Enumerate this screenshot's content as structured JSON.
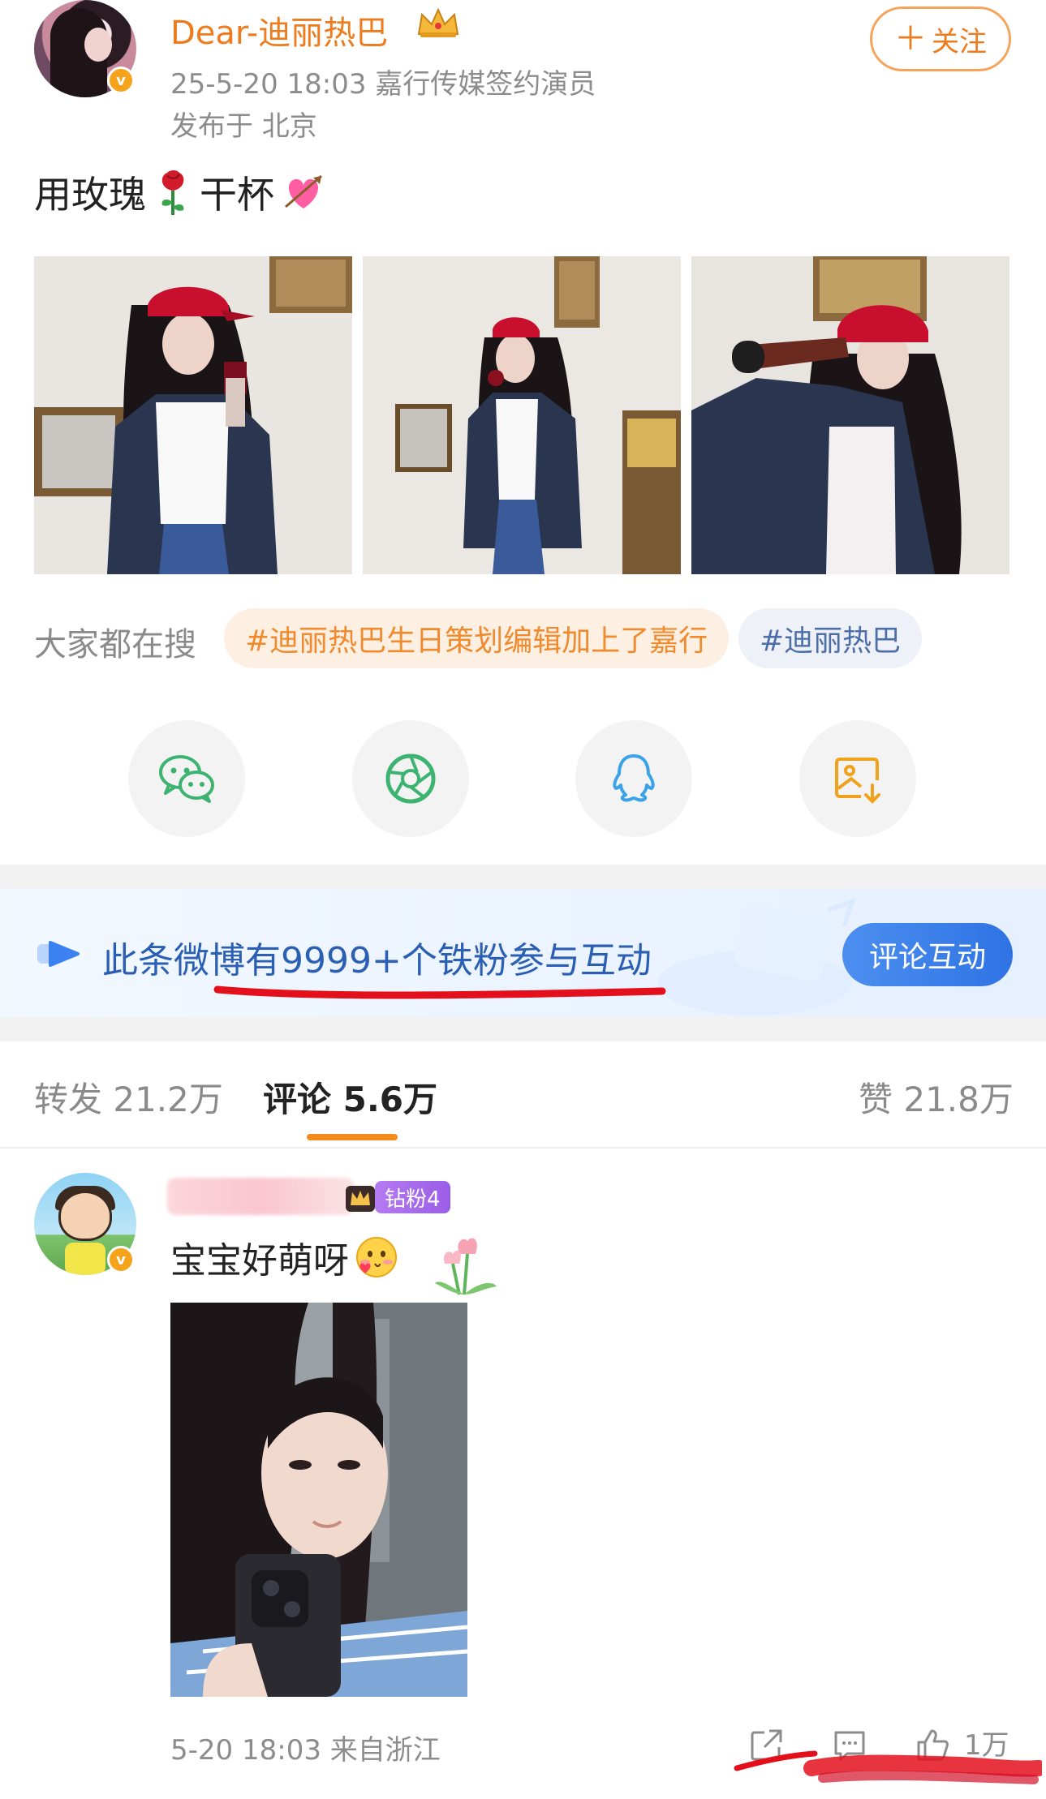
{
  "post": {
    "author_name": "Dear-迪丽热巴",
    "verified_badge": "v",
    "meta_line": "25-5-20 18:03  嘉行传媒签约演员",
    "location": "发布于 北京",
    "follow_label": "关注",
    "follow_plus": "＋",
    "text_part1": "用玫瑰",
    "text_part2": "干杯",
    "icons": [
      "crown-icon",
      "rose-emoji-icon",
      "heart-arrow-emoji-icon"
    ]
  },
  "search": {
    "label": "大家都在搜",
    "tags": [
      "#迪丽热巴生日策划编辑加上了嘉行",
      "#迪丽热巴"
    ]
  },
  "share": {
    "targets": [
      "wechat-icon",
      "moments-icon",
      "qq-icon",
      "save-image-icon"
    ],
    "colors": {
      "wechat": "#3cb371",
      "moments": "#3cb371",
      "qq": "#3aa3e8",
      "save": "#f1a21c"
    }
  },
  "banner": {
    "text": "此条微博有9999+个铁粉参与互动",
    "button": "评论互动"
  },
  "tabs": {
    "repost": "转发 21.2万",
    "comments": "评论 5.6万",
    "likes": "赞 21.8万"
  },
  "comment": {
    "fan_badge": "钻粉4",
    "text": "宝宝好萌呀",
    "meta": "5-20 18:03  来自浙江",
    "like_count": "1万",
    "icons": [
      "share-icon",
      "comment-icon",
      "like-icon"
    ]
  },
  "colors": {
    "accent_orange": "#ec7c1e",
    "link_blue": "#2b5fb3",
    "annotation_red": "#e3101c"
  }
}
